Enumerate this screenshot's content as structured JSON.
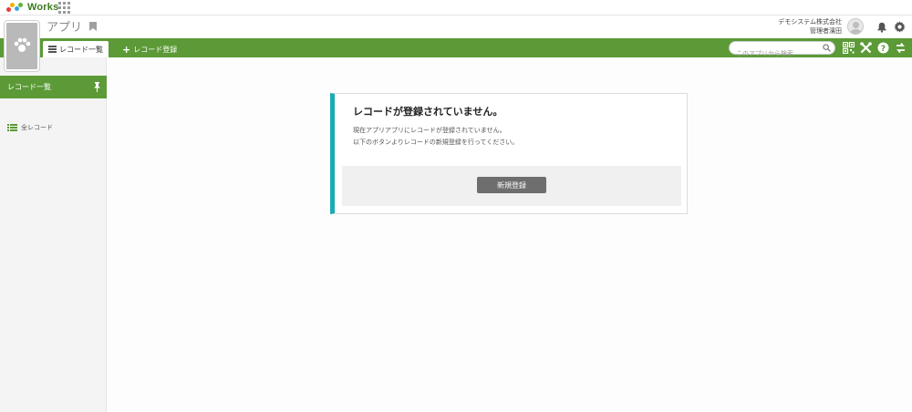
{
  "brand": {
    "name": "Works",
    "tagline": ""
  },
  "header": {
    "app_title": "アプリ",
    "user_company": "デモシステム株式会社",
    "user_name": "管理者濱田"
  },
  "nav": {
    "tab_list_label": "レコード一覧",
    "tab_add_label": "レコード登録",
    "search_placeholder": "このアプリから検索"
  },
  "sidebar": {
    "heading": "レコード一覧",
    "items": [
      {
        "label": "全レコード"
      }
    ]
  },
  "empty_state": {
    "title": "レコードが登録されていません。",
    "message_line1": "現在アプリアプリにレコードが登録されていません。",
    "message_line2": "以下のボタンよりレコードの新規登録を行ってください。",
    "button_label": "新規登録"
  },
  "colors": {
    "accent_green": "#5b9a36",
    "teal_border": "#1aacb3",
    "button_gray": "#6e6e6e"
  },
  "icons": [
    "apps-grid-icon",
    "bookmark-icon",
    "bell-icon",
    "gear-icon",
    "list-icon",
    "plus-icon",
    "search-icon",
    "qr-icon",
    "tools-icon",
    "help-icon",
    "switch-icon",
    "pin-icon"
  ]
}
